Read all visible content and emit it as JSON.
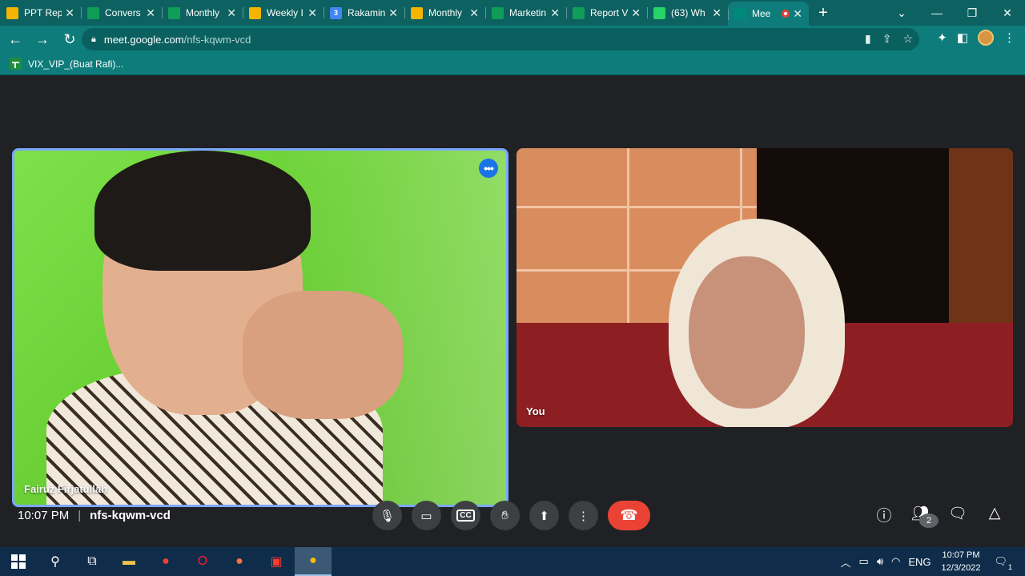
{
  "browser": {
    "tabs": [
      {
        "title": "PPT Rep",
        "favicon": "slides-icon",
        "color": "#f4b400",
        "glyph": ""
      },
      {
        "title": "Convers",
        "favicon": "sheets-icon",
        "color": "#0f9d58",
        "glyph": ""
      },
      {
        "title": "Monthly",
        "favicon": "sheets-icon",
        "color": "#0f9d58",
        "glyph": ""
      },
      {
        "title": "Weekly I",
        "favicon": "slides-icon",
        "color": "#f4b400",
        "glyph": ""
      },
      {
        "title": "Rakamin",
        "favicon": "calendar-icon",
        "color": "#4285f4",
        "glyph": "3"
      },
      {
        "title": "Monthly",
        "favicon": "slides-icon",
        "color": "#f4b400",
        "glyph": ""
      },
      {
        "title": "Marketin",
        "favicon": "sheets-icon",
        "color": "#0f9d58",
        "glyph": ""
      },
      {
        "title": "Report V",
        "favicon": "sheets-icon",
        "color": "#0f9d58",
        "glyph": ""
      },
      {
        "title": "(63) Wh",
        "favicon": "whatsapp-icon",
        "color": "#25d366",
        "glyph": ""
      },
      {
        "title": "Mee",
        "favicon": "meet-icon",
        "color": "#00897b",
        "glyph": "",
        "active": true
      }
    ],
    "url_host": "meet.google.com",
    "url_path": "/nfs-kqwm-vcd",
    "bookmark": "VIX_VIP_(Buat Rafi)..."
  },
  "meet": {
    "participants": [
      {
        "name": "Fairuz Firjatullah"
      },
      {
        "name": "You"
      }
    ],
    "time": "10:07 PM",
    "code": "nfs-kqwm-vcd",
    "people_count": "2",
    "accent": "#1a73e8",
    "end_color": "#ea4335"
  },
  "taskbar": {
    "lang": "ENG",
    "clock_time": "10:07 PM",
    "clock_date": "12/3/2022",
    "notifications": "1"
  }
}
